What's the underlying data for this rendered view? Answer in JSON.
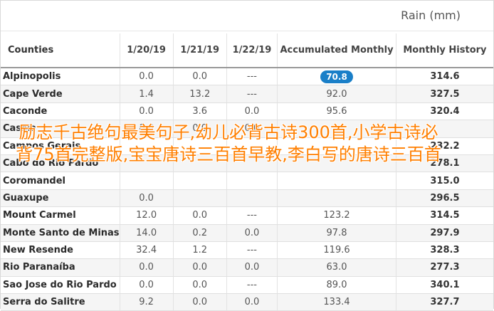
{
  "unit_label": "Rain (mm)",
  "columns": [
    "Counties",
    "1/20/19",
    "1/21/19",
    "1/22/19",
    "Accumulated Monthly",
    "Monthly History"
  ],
  "rows": [
    [
      "Alpinopolis",
      "0.0",
      "0.0",
      "---",
      "70.8",
      "314.6"
    ],
    [
      "Cape Verde",
      "1.4",
      "13.2",
      "---",
      "92.0",
      "327.5"
    ],
    [
      "Caconde",
      "0.0",
      "3.6",
      "0.0",
      "95.6",
      "320.4"
    ],
    [
      "Cassia",
      "0.0",
      "0.0",
      "0.0",
      "",
      ""
    ],
    [
      "Campos Gerais",
      "",
      "",
      "",
      "",
      "232.2"
    ],
    [
      "Cabo do Rio Pardo",
      "",
      "",
      "",
      "",
      "278.1"
    ],
    [
      "Coromandel",
      "",
      "",
      "",
      "",
      "315.0"
    ],
    [
      "Guaxupe",
      "0.0",
      "",
      "",
      "",
      "296.5"
    ],
    [
      "Mount Carmel",
      "12.0",
      "0.0",
      "---",
      "123.2",
      "314.5"
    ],
    [
      "Monte Santo de Minas",
      "14.0",
      "0.2",
      "0.0",
      "97.8",
      "297.9"
    ],
    [
      "New Resende",
      "32.4",
      "1.2",
      "---",
      "119.6",
      "328.3"
    ],
    [
      "Rio Paranaíba",
      "0.0",
      "0.0",
      "0.0",
      "63.0",
      "277.3"
    ],
    [
      "Sao Jose do Rio Pardo",
      "0.0",
      "0.0",
      "---",
      "89.0",
      "340.1"
    ],
    [
      "Serra do Salitre",
      "9.2",
      "0.0",
      "0.0",
      "133.4",
      "327.7"
    ]
  ],
  "highlight": {
    "row": 0,
    "col": 4
  },
  "overlay_text": "励志千古绝句最美句子,幼儿必背古诗300首,小学古诗必背75首完整版,宝宝唐诗三百首早教,李白写的唐诗三百首",
  "colors": {
    "pill": "#1a7fc8",
    "overlay": "#ff7f00"
  }
}
